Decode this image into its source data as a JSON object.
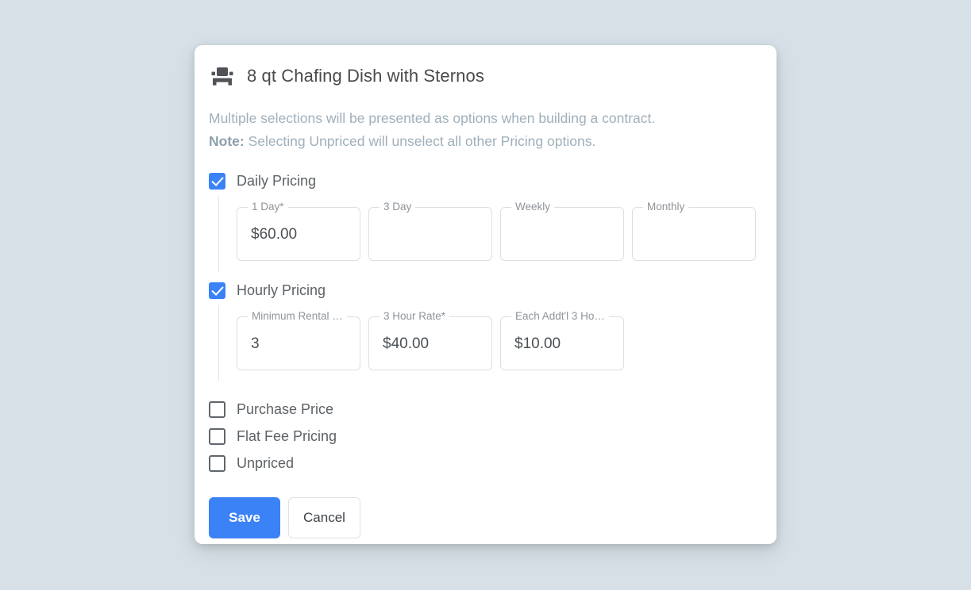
{
  "colors": {
    "page_background": "#d6e0e6",
    "card_background": "#ffffff",
    "accent_blue": "#3b82f6",
    "description_text": "#9fb0bb",
    "label_text": "#8f9499",
    "value_text": "#4b5055",
    "field_border": "#dcdfe2"
  },
  "dialog": {
    "icon_name": "chafing-dish-icon",
    "title": "8 qt Chafing Dish with Sternos",
    "description": {
      "line1": "Multiple selections will be presented as options when building a contract.",
      "note_label": "Note:",
      "note_text": " Selecting Unpriced will unselect all other Pricing options."
    },
    "daily_pricing": {
      "label": "Daily Pricing",
      "checked": true,
      "fields": [
        {
          "label": "1 Day*",
          "value": "$60.00"
        },
        {
          "label": "3 Day",
          "value": ""
        },
        {
          "label": "Weekly",
          "value": ""
        },
        {
          "label": "Monthly",
          "value": ""
        }
      ]
    },
    "hourly_pricing": {
      "label": "Hourly Pricing",
      "checked": true,
      "fields": [
        {
          "label": "Minimum Rental …",
          "value": "3"
        },
        {
          "label": "3 Hour Rate*",
          "value": "$40.00"
        },
        {
          "label": "Each Addt'l 3 Ho…",
          "value": "$10.00"
        }
      ]
    },
    "other_options": [
      {
        "label": "Purchase Price",
        "checked": false
      },
      {
        "label": "Flat Fee Pricing",
        "checked": false
      },
      {
        "label": "Unpriced",
        "checked": false
      }
    ],
    "buttons": {
      "save": "Save",
      "cancel": "Cancel"
    }
  }
}
